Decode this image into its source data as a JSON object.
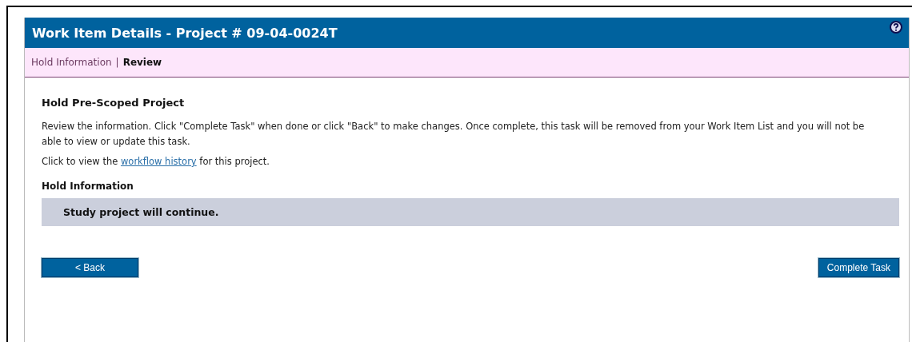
{
  "window": {
    "title": "Work Item Details - Project # 09-04-0024T"
  },
  "breadcrumb": {
    "separator": "|",
    "items": [
      {
        "label": "Hold Information",
        "selected": false
      },
      {
        "label": "Review",
        "selected": true
      }
    ]
  },
  "heading": "Hold Pre-Scoped Project",
  "instructions": "Review the information. Click \"Complete Task\" when done or click \"Back\" to make changes. Once complete, this task will be removed from your Work Item List and you will not be able to view or update this task.",
  "history_line": {
    "before": "Click to view the",
    "link": "workflow history",
    "after": "for this project."
  },
  "section": {
    "title": "Hold Information",
    "message": "Study project will continue."
  },
  "buttons": {
    "back": "< Back",
    "complete": "Complete Task"
  }
}
